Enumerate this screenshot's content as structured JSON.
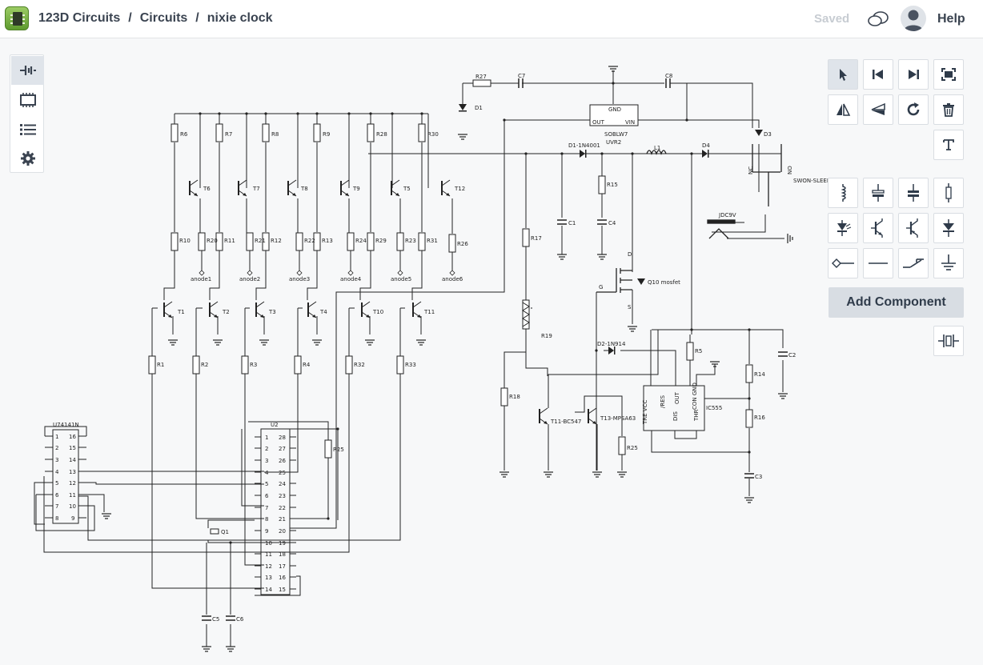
{
  "header": {
    "breadcrumb": [
      "123D Circuits",
      "Circuits",
      "nixie clock"
    ],
    "separator": "/",
    "saved_label": "Saved",
    "help_label": "Help"
  },
  "left_panel": {
    "items": [
      {
        "icon": "breadboard-view-icon",
        "active": true
      },
      {
        "icon": "chip-view-icon",
        "active": false
      },
      {
        "icon": "list-icon",
        "active": false
      },
      {
        "icon": "gear-icon",
        "active": false
      }
    ]
  },
  "toolbar": {
    "add_component_label": "Add Component",
    "tools": [
      "select-arrow",
      "step-back",
      "step-forward",
      "fit-screen",
      "flip-horizontal",
      "flip-vertical",
      "rotate",
      "delete",
      "text"
    ],
    "components": [
      "inductor",
      "capacitor-polarized",
      "capacitor",
      "resistor",
      "led",
      "npn-transistor",
      "pnp-transistor",
      "diode",
      "probe",
      "wire",
      "switch",
      "ground"
    ],
    "extra": [
      "battery"
    ]
  },
  "schematic": {
    "resistors": [
      "R6",
      "R7",
      "R8",
      "R9",
      "R28",
      "R30",
      "R10",
      "R20",
      "R11",
      "R21",
      "R12",
      "R22",
      "R13",
      "R24",
      "R29",
      "R23",
      "R31",
      "R26",
      "R1",
      "R2",
      "R3",
      "R4",
      "R32",
      "R33",
      "R25",
      "R27",
      "R18",
      "R17",
      "R19",
      "R15",
      "R5",
      "R14",
      "R16",
      "R25"
    ],
    "anodes": [
      "anode1",
      "anode2",
      "anode3",
      "anode4",
      "anode5",
      "anode6"
    ],
    "transistors_top": [
      "T6",
      "T7",
      "T8",
      "T9",
      "T5",
      "T12"
    ],
    "transistors_mid": [
      "T1",
      "T2",
      "T3",
      "T4",
      "T10",
      "T11"
    ],
    "regulator": {
      "gnd": "GND",
      "out": "OUT",
      "in": "VIN",
      "part": "SOBLW7",
      "ref": "UVR2"
    },
    "labels": {
      "r27": "R27",
      "c7": "C7",
      "c8": "C8",
      "d1": "D1",
      "d3": "D3",
      "d1_part": "D1-1N4001",
      "l1": "L1",
      "d4": "D4",
      "sw": "SWON-SLEEP",
      "jdc": "JDC9V",
      "c1": "C1",
      "c4": "C4",
      "mosfet": "Q10 mosfet",
      "d": "D",
      "g": "G",
      "s": "S",
      "d2": "D2-1N914",
      "t11": "T11-BC547",
      "t13": "T13-MPSA63",
      "ic": "IC555",
      "c2": "C2",
      "c3": "C3",
      "u1": "U74141N",
      "u2": "U2",
      "q1": "Q1",
      "c5": "C5",
      "c6": "C6",
      "nc": "NC",
      "no": "NO"
    },
    "ic555_pins_top": [
      "TRE VCC",
      "/RES",
      "OUT",
      "CON GND"
    ],
    "ic555_pins_bottom": [
      "DIS",
      "THR"
    ],
    "u1_left_pins": [
      "1",
      "2",
      "3",
      "4",
      "5",
      "6",
      "7",
      "8"
    ],
    "u1_right_pins": [
      "16",
      "15",
      "14",
      "13",
      "12",
      "11",
      "10",
      "9"
    ],
    "u2_left_pins": [
      "1",
      "2",
      "3",
      "4",
      "5",
      "6",
      "7",
      "8",
      "9",
      "10",
      "11",
      "12",
      "13",
      "14"
    ],
    "u2_right_pins": [
      "28",
      "27",
      "26",
      "25",
      "24",
      "23",
      "22",
      "21",
      "20",
      "19",
      "18",
      "17",
      "16",
      "15"
    ]
  }
}
